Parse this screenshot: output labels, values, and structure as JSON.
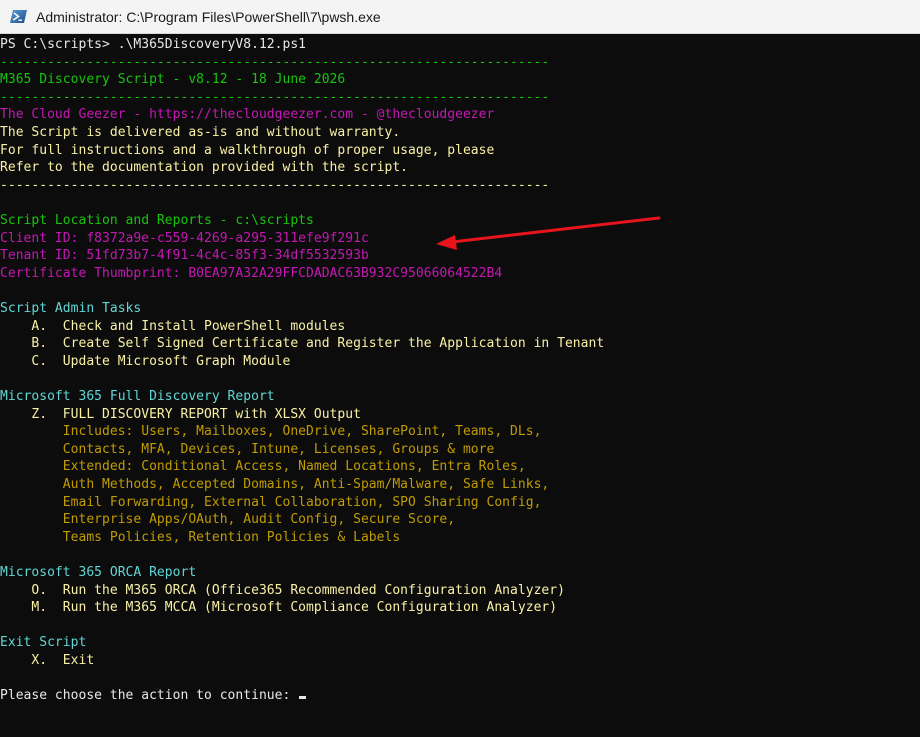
{
  "window": {
    "title": "Administrator: C:\\Program Files\\PowerShell\\7\\pwsh.exe",
    "icon": "powershell-icon"
  },
  "colors": {
    "background": "#0c0c0c",
    "white": "#e8e8e8",
    "green": "#16c60c",
    "magenta": "#c418b4",
    "yellow": "#f9f1a5",
    "dark_yellow": "#c19c00",
    "cyan": "#61d6d6",
    "arrow": "#e8141c"
  },
  "console": {
    "prompt_line": "PS C:\\scripts> .\\M365DiscoveryV8.12.ps1",
    "separator": "----------------------------------------------------------------------",
    "banner_title": "M365 Discovery Script - v8.12 - 18 June 2026",
    "author_line": "The Cloud Geezer - https://thecloudgeezer.com - @thecloudgeezer",
    "disclaimer_1": "The Script is delivered as-is and without warranty.",
    "disclaimer_2": "For full instructions and a walkthrough of proper usage, please",
    "disclaimer_3": "Refer to the documentation provided with the script.",
    "location_line": "Script Location and Reports - c:\\scripts",
    "client_id": "Client ID: f8372a9e-c559-4269-a295-311efe9f291c",
    "tenant_id": "Tenant ID: 51fd73b7-4f91-4c4c-85f3-34df5532593b",
    "cert_thumb": "Certificate Thumbprint: B0EA97A32A29FFCDADAC63B932C95066064522B4",
    "admin_header": "Script Admin Tasks",
    "admin_a": "    A.  Check and Install PowerShell modules",
    "admin_b": "    B.  Create Self Signed Certificate and Register the Application in Tenant",
    "admin_c": "    C.  Update Microsoft Graph Module",
    "discovery_header": "Microsoft 365 Full Discovery Report",
    "discovery_z": "    Z.  FULL DISCOVERY REPORT with XLSX Output",
    "includes_1": "        Includes: Users, Mailboxes, OneDrive, SharePoint, Teams, DLs,",
    "includes_2": "        Contacts, MFA, Devices, Intune, Licenses, Groups & more",
    "includes_3": "        Extended: Conditional Access, Named Locations, Entra Roles,",
    "includes_4": "        Auth Methods, Accepted Domains, Anti-Spam/Malware, Safe Links,",
    "includes_5": "        Email Forwarding, External Collaboration, SPO Sharing Config,",
    "includes_6": "        Enterprise Apps/OAuth, Audit Config, Secure Score,",
    "includes_7": "        Teams Policies, Retention Policies & Labels",
    "orca_header": "Microsoft 365 ORCA Report",
    "orca_o": "    O.  Run the M365 ORCA (Office365 Recommended Configuration Analyzer)",
    "orca_m": "    M.  Run the M365 MCCA (Microsoft Compliance Configuration Analyzer)",
    "exit_header": "Exit Script",
    "exit_x": "    X.  Exit",
    "input_prompt": "Please choose the action to continue: "
  }
}
